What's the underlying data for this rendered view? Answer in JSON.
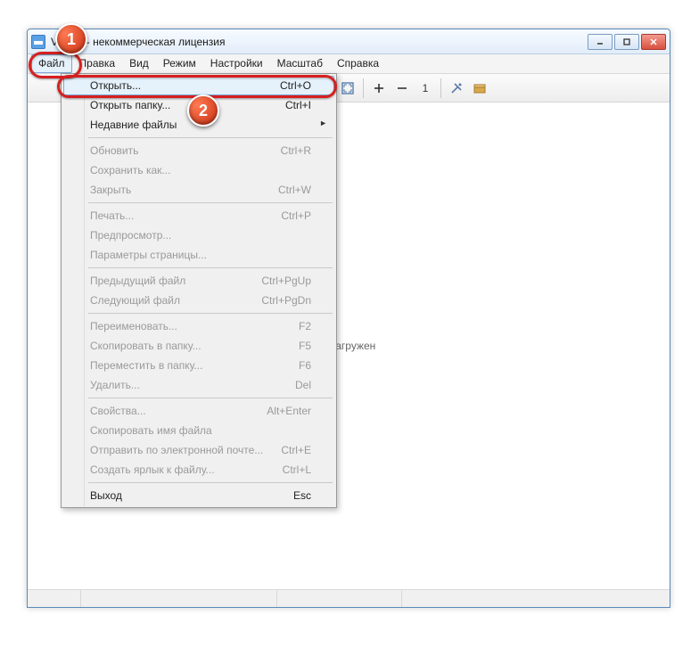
{
  "window": {
    "title_suffix": "Viewer - некоммерческая лицензия"
  },
  "menubar": {
    "items": [
      "Файл",
      "Правка",
      "Вид",
      "Режим",
      "Настройки",
      "Масштаб",
      "Справка"
    ]
  },
  "toolbar": {
    "one_label": "1"
  },
  "content": {
    "message_tail": "е загружен"
  },
  "dropdown": {
    "items": [
      {
        "label": "Открыть...",
        "shortcut": "Ctrl+O",
        "enabled": true,
        "highlight": true
      },
      {
        "label": "Открыть папку...",
        "shortcut": "Ctrl+I",
        "enabled": true
      },
      {
        "label": "Недавние файлы",
        "submenu": true,
        "enabled": true
      },
      {
        "sep": true
      },
      {
        "label": "Обновить",
        "shortcut": "Ctrl+R",
        "enabled": false
      },
      {
        "label": "Сохранить как...",
        "enabled": false
      },
      {
        "label": "Закрыть",
        "shortcut": "Ctrl+W",
        "enabled": false
      },
      {
        "sep": true
      },
      {
        "label": "Печать...",
        "shortcut": "Ctrl+P",
        "enabled": false
      },
      {
        "label": "Предпросмотр...",
        "enabled": false
      },
      {
        "label": "Параметры страницы...",
        "enabled": false
      },
      {
        "sep": true
      },
      {
        "label": "Предыдущий файл",
        "shortcut": "Ctrl+PgUp",
        "enabled": false
      },
      {
        "label": "Следующий файл",
        "shortcut": "Ctrl+PgDn",
        "enabled": false
      },
      {
        "sep": true
      },
      {
        "label": "Переименовать...",
        "shortcut": "F2",
        "enabled": false
      },
      {
        "label": "Скопировать в папку...",
        "shortcut": "F5",
        "enabled": false
      },
      {
        "label": "Переместить в папку...",
        "shortcut": "F6",
        "enabled": false
      },
      {
        "label": "Удалить...",
        "shortcut": "Del",
        "enabled": false
      },
      {
        "sep": true
      },
      {
        "label": "Свойства...",
        "shortcut": "Alt+Enter",
        "enabled": false
      },
      {
        "label": "Скопировать имя файла",
        "enabled": false
      },
      {
        "label": "Отправить по электронной почте...",
        "shortcut": "Ctrl+E",
        "enabled": false
      },
      {
        "label": "Создать ярлык к файлу...",
        "shortcut": "Ctrl+L",
        "enabled": false
      },
      {
        "sep": true
      },
      {
        "label": "Выход",
        "shortcut": "Esc",
        "enabled": true
      }
    ]
  },
  "callouts": {
    "badge1": "1",
    "badge2": "2"
  }
}
